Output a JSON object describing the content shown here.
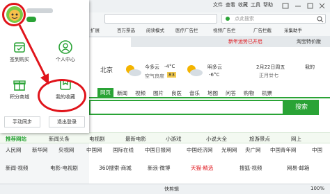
{
  "titlebar": {
    "menus": [
      "文件",
      "查看",
      "收藏",
      "工具",
      "帮助"
    ]
  },
  "search": {
    "placeholder": "点此搜索"
  },
  "favorites": [
    "扩展",
    "百万票选",
    "阅读模式",
    "医疗广告拦",
    "视频广告拦",
    "广告拦截",
    "采集助手"
  ],
  "page_tabs": {
    "right1": "新年运势已开启",
    "right2": "淘宝特价版"
  },
  "weather": {
    "city": "北京",
    "today_label": "今多云",
    "today_temp": "-4°C",
    "aqi_label": "空气良度",
    "aqi_value": "83",
    "tomorrow_label": "明多云",
    "tomorrow_temp": "-6°C",
    "date": "2月22日周五",
    "lunar": "正月廿七",
    "extra": "我的"
  },
  "nav": [
    "网页",
    "新闻",
    "视频",
    "图片",
    "良医",
    "音乐",
    "地图",
    "问答",
    "购物",
    "机票"
  ],
  "search_button": "搜索",
  "categories": [
    "推荐网站",
    "新闻头条",
    "电视剧",
    "最新电影",
    "小游戏",
    "小说大全",
    "旅游景点",
    "网上"
  ],
  "sites": [
    "人民网",
    "新华网",
    "央视网",
    "中国网",
    "国际在线",
    "中国日报网",
    "中国经济网",
    "光明网",
    "央广网",
    "中国青年网",
    "中国"
  ],
  "subrow": [
    "新闻·视频",
    "电影·电视剧",
    "360搜索·商城",
    "新浪·微博",
    "天猫·精选",
    "搜狐·视频",
    "网易·邮箱"
  ],
  "popup": {
    "items": [
      "签到购买",
      "个人中心",
      "积分商城",
      "我的收藏"
    ],
    "buttons": [
      "手动同步",
      "退出登录"
    ]
  },
  "statusbar": {
    "label": "快剪辑",
    "zoom": "100%"
  },
  "colors": {
    "brand_green": "#2aa336",
    "annotation_red": "#e0141b"
  }
}
